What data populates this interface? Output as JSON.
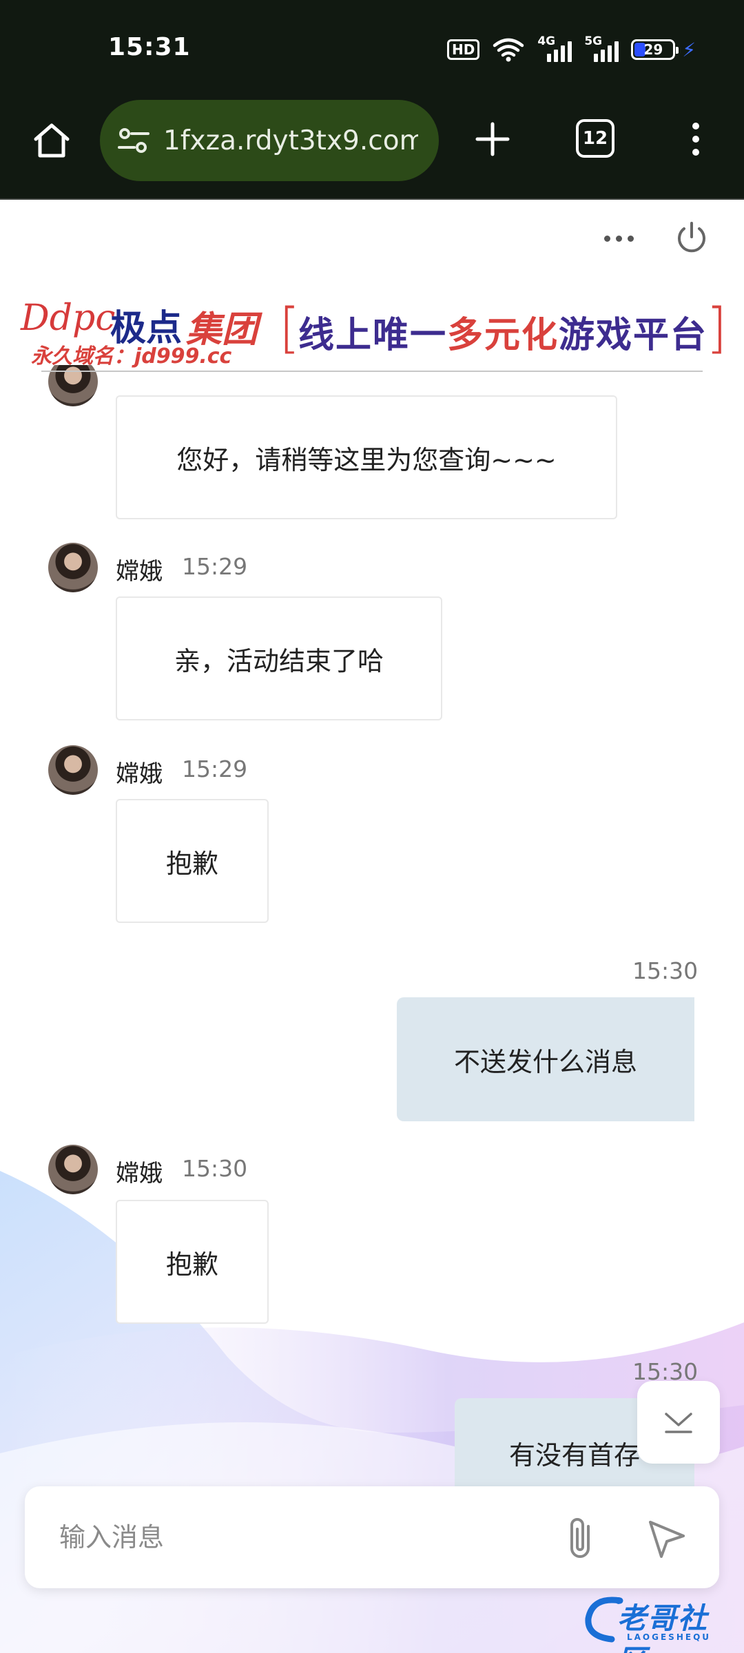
{
  "status_bar": {
    "time": "15:31",
    "hd": "HD",
    "net1": "4G",
    "net2": "5G",
    "battery": "29",
    "battery_level": 0.29,
    "charging_color": "#3c6cff"
  },
  "browser": {
    "url": "1fxza.rdyt3tx9.com",
    "tab_count": "12",
    "icons": [
      "home-icon",
      "tune-icon",
      "plus-icon",
      "tabs-icon",
      "more-vert-icon"
    ],
    "url_bar_color": "#2c4a18"
  },
  "page_header": {
    "icons": [
      "more-horiz-icon",
      "power-icon"
    ]
  },
  "banner": {
    "logo_script": "Ddpc",
    "logo_cn_1": "极点",
    "logo_cn_2": "集团",
    "domain": "永久域名：jd999.cc",
    "slogan_1": "线上唯一",
    "slogan_2": "多元化",
    "slogan_3": "游戏平台"
  },
  "messages": [
    {
      "direction": "in",
      "sender": "",
      "time": "",
      "text": "您好，请稍等这里为您查询~~~"
    },
    {
      "direction": "in",
      "sender": "嫦娥",
      "time": "15:29",
      "text": "亲，活动结束了哈"
    },
    {
      "direction": "in",
      "sender": "嫦娥",
      "time": "15:29",
      "text": "抱歉"
    },
    {
      "direction": "out",
      "sender": "",
      "time": "15:30",
      "text": "不送发什么消息"
    },
    {
      "direction": "in",
      "sender": "嫦娥",
      "time": "15:30",
      "text": "抱歉"
    },
    {
      "direction": "out",
      "sender": "",
      "time": "15:30",
      "text": "有没有首存"
    }
  ],
  "composer": {
    "placeholder": "输入消息",
    "icons": [
      "paperclip-icon",
      "send-icon",
      "chevron-down-icon"
    ]
  },
  "watermark": {
    "text": "老哥社区",
    "sub": "LAOGESHEQU"
  }
}
